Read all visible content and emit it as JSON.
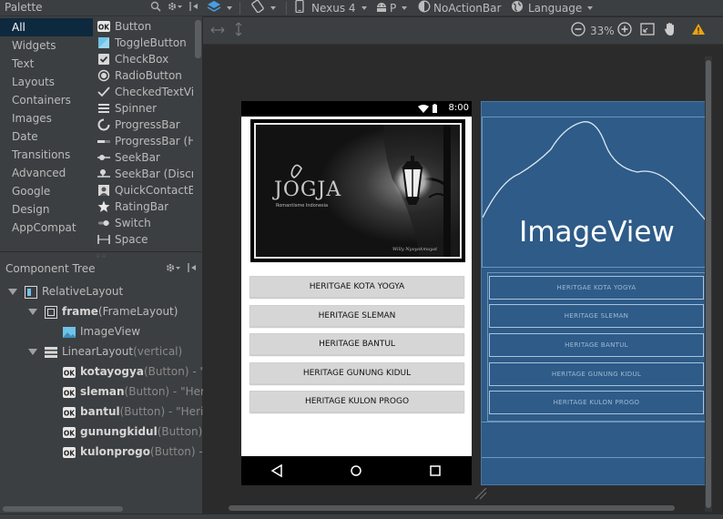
{
  "palette": {
    "title": "Palette",
    "categories": [
      "All",
      "Widgets",
      "Text",
      "Layouts",
      "Containers",
      "Images",
      "Date",
      "Transitions",
      "Advanced",
      "Google",
      "Design",
      "AppCompat"
    ],
    "selected_category": "All",
    "widgets": [
      {
        "label": "Button",
        "icon": "ok-button-icon"
      },
      {
        "label": "ToggleButton",
        "icon": "toggle-button-icon"
      },
      {
        "label": "CheckBox",
        "icon": "checkbox-icon"
      },
      {
        "label": "RadioButton",
        "icon": "radio-button-icon"
      },
      {
        "label": "CheckedTextVie",
        "icon": "checked-text-icon"
      },
      {
        "label": "Spinner",
        "icon": "spinner-icon"
      },
      {
        "label": "ProgressBar",
        "icon": "progress-circle-icon"
      },
      {
        "label": "ProgressBar (Ho",
        "icon": "progress-horizontal-icon"
      },
      {
        "label": "SeekBar",
        "icon": "seekbar-icon"
      },
      {
        "label": "SeekBar (Discret",
        "icon": "seekbar-discrete-icon"
      },
      {
        "label": "QuickContactBa",
        "icon": "quick-contact-icon"
      },
      {
        "label": "RatingBar",
        "icon": "star-icon"
      },
      {
        "label": "Switch",
        "icon": "switch-icon"
      },
      {
        "label": "Space",
        "icon": "space-icon"
      }
    ]
  },
  "component_tree": {
    "title": "Component Tree",
    "nodes": [
      {
        "name": "RelativeLayout",
        "detail": "",
        "icon": "relative-layout-icon"
      },
      {
        "name": "frame",
        "detail": " (FrameLayout)",
        "icon": "frame-layout-icon"
      },
      {
        "name": "ImageView",
        "detail": "",
        "icon": "image-view-icon"
      },
      {
        "name": "LinearLayout",
        "detail": " (vertical)",
        "icon": "linear-layout-icon"
      },
      {
        "name": "kotayogya",
        "detail": " (Button) - \"He",
        "icon": "ok-button-icon"
      },
      {
        "name": "sleman",
        "detail": " (Button) - \"Herita",
        "icon": "ok-button-icon"
      },
      {
        "name": "bantul",
        "detail": " (Button) - \"Heritag",
        "icon": "ok-button-icon"
      },
      {
        "name": "gunungkidul",
        "detail": " (Button) - \"",
        "icon": "ok-button-icon"
      },
      {
        "name": "kulonprogo",
        "detail": " (Button) - \"H",
        "icon": "ok-button-icon"
      }
    ]
  },
  "toolbar": {
    "device": "Nexus 4",
    "api": "P",
    "theme": "NoActionBar",
    "language": "Language",
    "zoom": "33%"
  },
  "device": {
    "time": "8:00",
    "image_text": "JOGJA",
    "image_subtext": "Romantisme Indonesia",
    "image_signature": "Willy Nyoyokmuyat",
    "buttons": [
      "HERITGAE KOTA YOGYA",
      "HERITAGE SLEMAN",
      "HERITAGE BANTUL",
      "HERITAGE GUNUNG KIDUL",
      "HERITAGE KULON PROGO"
    ]
  },
  "blueprint": {
    "image_label": "ImageView",
    "buttons": [
      "HERITGAE KOTA YOGYA",
      "HERITAGE SLEMAN",
      "HERITAGE BANTUL",
      "HERITAGE GUNUNG KIDUL",
      "HERITAGE KULON PROGO"
    ]
  },
  "colors": {
    "panel": "#3c3f41",
    "canvas": "#2b2b2b",
    "selection": "#0d293e",
    "blueprint": "#2e5b88",
    "warning": "#f0a30a"
  }
}
